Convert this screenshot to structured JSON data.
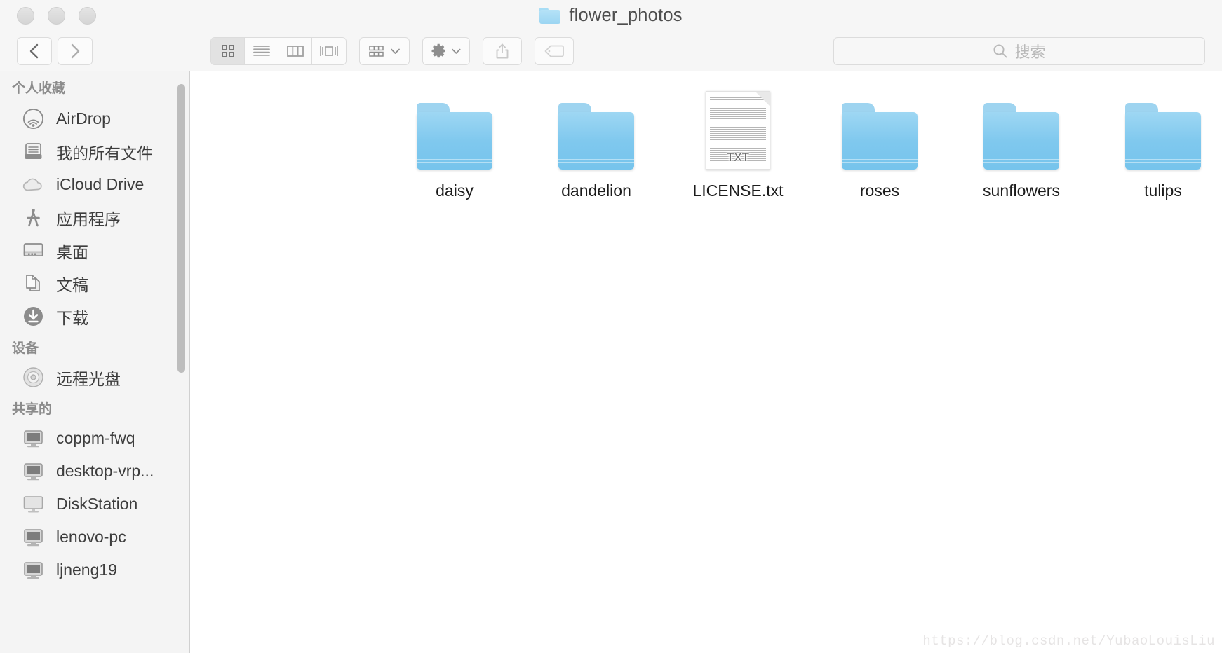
{
  "window": {
    "title": "flower_photos",
    "title_icon": "folder-icon",
    "traffic_lights": [
      {
        "name": "close-button",
        "color": "#e0e0e0"
      },
      {
        "name": "minimize-button",
        "color": "#e0e0e0"
      },
      {
        "name": "zoom-button",
        "color": "#e0e0e0"
      }
    ]
  },
  "toolbar": {
    "back_icon": "chevron-left-icon",
    "forward_icon": "chevron-right-icon",
    "view_modes": [
      {
        "name": "icon-view",
        "icon": "grid-icon",
        "active": true
      },
      {
        "name": "list-view",
        "icon": "list-icon",
        "active": false
      },
      {
        "name": "column-view",
        "icon": "columns-icon",
        "active": false
      },
      {
        "name": "coverflow-view",
        "icon": "coverflow-icon",
        "active": false
      }
    ],
    "arrange_button": {
      "icon": "arrange-grid-icon",
      "chevron": "chevron-down-icon"
    },
    "action_button": {
      "icon": "gear-icon",
      "chevron": "chevron-down-icon"
    },
    "share_button": {
      "icon": "share-icon"
    },
    "tag_button": {
      "icon": "tag-icon"
    }
  },
  "search": {
    "icon": "search-icon",
    "placeholder": "搜索",
    "value": ""
  },
  "sidebar": {
    "sections": [
      {
        "header": "个人收藏",
        "items": [
          {
            "label": "AirDrop",
            "icon": "airdrop-icon"
          },
          {
            "label": "我的所有文件",
            "icon": "all-my-files-icon"
          },
          {
            "label": "iCloud Drive",
            "icon": "icloud-icon"
          },
          {
            "label": "应用程序",
            "icon": "applications-icon"
          },
          {
            "label": "桌面",
            "icon": "desktop-icon"
          },
          {
            "label": "文稿",
            "icon": "documents-icon"
          },
          {
            "label": "下载",
            "icon": "downloads-icon"
          }
        ]
      },
      {
        "header": "设备",
        "items": [
          {
            "label": "远程光盘",
            "icon": "optical-disc-icon"
          }
        ]
      },
      {
        "header": "共享的",
        "items": [
          {
            "label": "coppm-fwq",
            "icon": "computer-icon"
          },
          {
            "label": "desktop-vrp...",
            "icon": "computer-icon"
          },
          {
            "label": "DiskStation",
            "icon": "display-icon"
          },
          {
            "label": "lenovo-pc",
            "icon": "computer-icon"
          },
          {
            "label": "ljneng19",
            "icon": "computer-icon"
          }
        ]
      }
    ]
  },
  "content": {
    "items": [
      {
        "label": "daisy",
        "kind": "folder"
      },
      {
        "label": "dandelion",
        "kind": "folder"
      },
      {
        "label": "LICENSE.txt",
        "kind": "text-document",
        "badge": "TXT"
      },
      {
        "label": "roses",
        "kind": "folder"
      },
      {
        "label": "sunflowers",
        "kind": "folder"
      },
      {
        "label": "tulips",
        "kind": "folder"
      }
    ]
  },
  "watermark": {
    "text": "https://blog.csdn.net/YubaoLouisLiu"
  },
  "colors": {
    "folder_blue": "#8ccdf0",
    "titlebar_bg": "#f6f6f6",
    "sidebar_bg": "#f4f4f4",
    "content_bg": "#ffffff"
  }
}
